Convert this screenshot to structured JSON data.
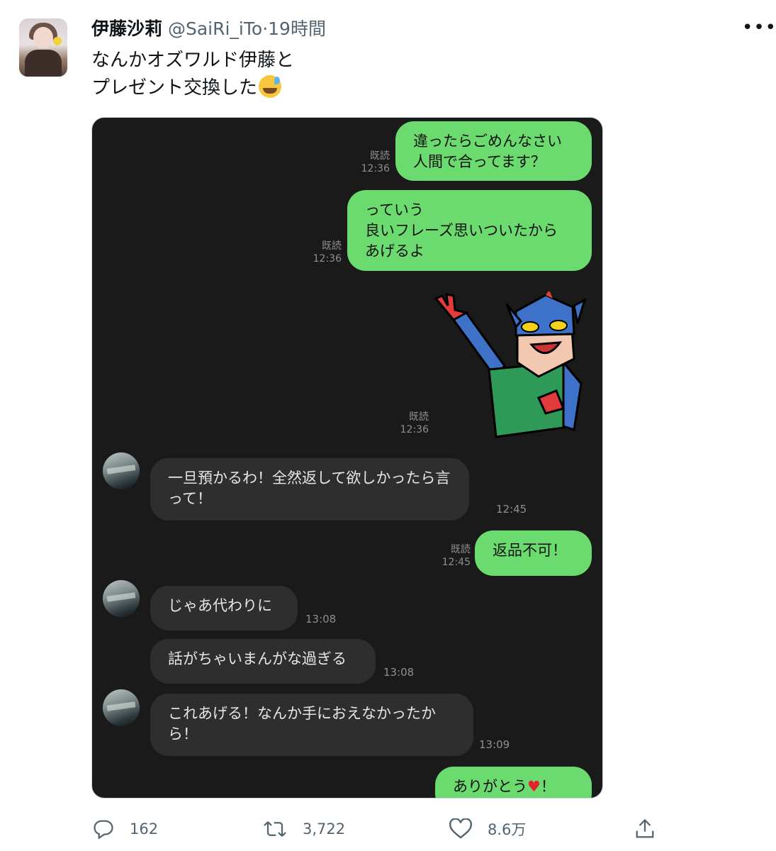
{
  "tweet": {
    "author_name": "伊藤沙莉",
    "handle": "@SaiRi_iTo",
    "separator": "·",
    "time": "19時間",
    "more_label": "•••",
    "text_line1": "なんかオズワルド伊藤と",
    "text_line2": "プレゼント交換した"
  },
  "chat": {
    "read_label": "既読",
    "messages": [
      {
        "line1": "違ったらごめんなさい",
        "line2": "人間で合ってます？",
        "time": "12:36"
      },
      {
        "line1": "っていう",
        "line2": "良いフレーズ思いついたから",
        "line3": "あげるよ",
        "time": "12:36"
      },
      {
        "sticker_time": "12:36"
      },
      {
        "line1": "一旦預かるわ！全然返して欲しかったら言",
        "line2": "って！",
        "time": "12:45"
      },
      {
        "line1": "返品不可！",
        "time": "12:45"
      },
      {
        "line1": "じゃあ代わりに",
        "time": "13:08"
      },
      {
        "line1": "話がちゃいまんがな過ぎる",
        "time": "13:08"
      },
      {
        "line1": "これあげる！なんか手におえなかったか",
        "line2": "ら！",
        "time": "13:09"
      },
      {
        "line1": "ありがとう",
        "line2": "！"
      }
    ]
  },
  "actions": {
    "replies": "162",
    "retweets": "3,722",
    "likes": "8.6万"
  },
  "colors": {
    "outgoing_bubble": "#6bdb6f",
    "incoming_bubble": "#2e2e2e",
    "chat_background": "#1a1a1a",
    "secondary_text": "#536471"
  }
}
